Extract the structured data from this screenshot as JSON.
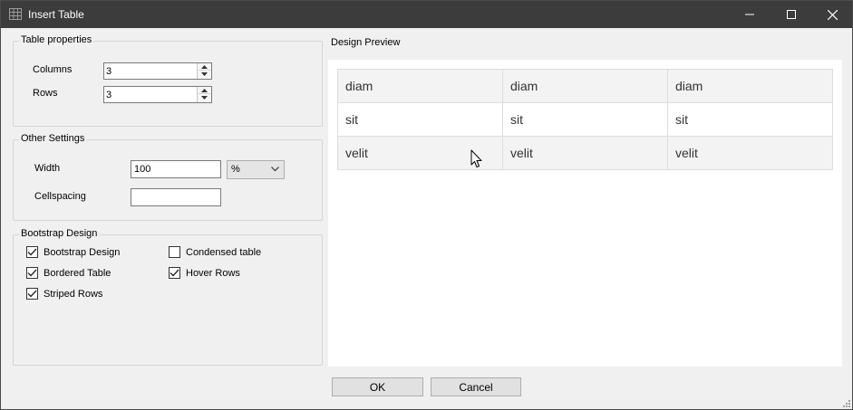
{
  "window": {
    "title": "Insert Table"
  },
  "table_properties": {
    "title": "Table properties",
    "columns_label": "Columns",
    "columns_value": "3",
    "rows_label": "Rows",
    "rows_value": "3"
  },
  "other_settings": {
    "title": "Other Settings",
    "width_label": "Width",
    "width_value": "100",
    "unit_value": "%",
    "cellspacing_label": "Cellspacing",
    "cellspacing_value": ""
  },
  "bootstrap": {
    "title": "Bootstrap Design",
    "options": [
      {
        "label": "Bootstrap Design",
        "checked": true
      },
      {
        "label": "Condensed table",
        "checked": false
      },
      {
        "label": "Bordered Table",
        "checked": true
      },
      {
        "label": "Hover Rows",
        "checked": true
      },
      {
        "label": "Striped Rows",
        "checked": true
      }
    ]
  },
  "preview": {
    "title": "Design Preview",
    "rows": [
      [
        "diam",
        "diam",
        "diam"
      ],
      [
        "sit",
        "sit",
        "sit"
      ],
      [
        "velit",
        "velit",
        "velit"
      ]
    ]
  },
  "buttons": {
    "ok": "OK",
    "cancel": "Cancel"
  },
  "colors": {
    "titlebar": "#3c3c3c",
    "dialog_bg": "#f0f0f0",
    "stripe": "#f3f3f3"
  },
  "icons": [
    "table-icon",
    "minimize-icon",
    "maximize-icon",
    "close-icon",
    "spin-up-icon",
    "spin-down-icon",
    "chevron-down-icon",
    "checkmark-icon",
    "mouse-cursor-icon",
    "resize-grip-icon"
  ]
}
